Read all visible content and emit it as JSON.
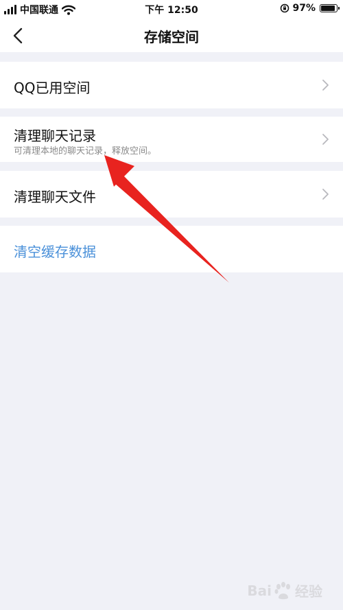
{
  "status_bar": {
    "carrier": "中国联通",
    "time": "下午 12:50",
    "battery": "97%",
    "battery_level": 0.97
  },
  "nav": {
    "title": "存储空间"
  },
  "rows": [
    {
      "title": "QQ已用空间"
    },
    {
      "title": "清理聊天记录",
      "subtitle": "可清理本地的聊天记录，释放空间。"
    },
    {
      "title": "清理聊天文件"
    },
    {
      "title": "清空缓存数据"
    }
  ],
  "colors": {
    "background": "#f0f1f7",
    "action_text": "#4a90d9",
    "annotation_arrow": "#e8231f"
  },
  "watermark": {
    "left": "Bai",
    "right": "经验"
  }
}
